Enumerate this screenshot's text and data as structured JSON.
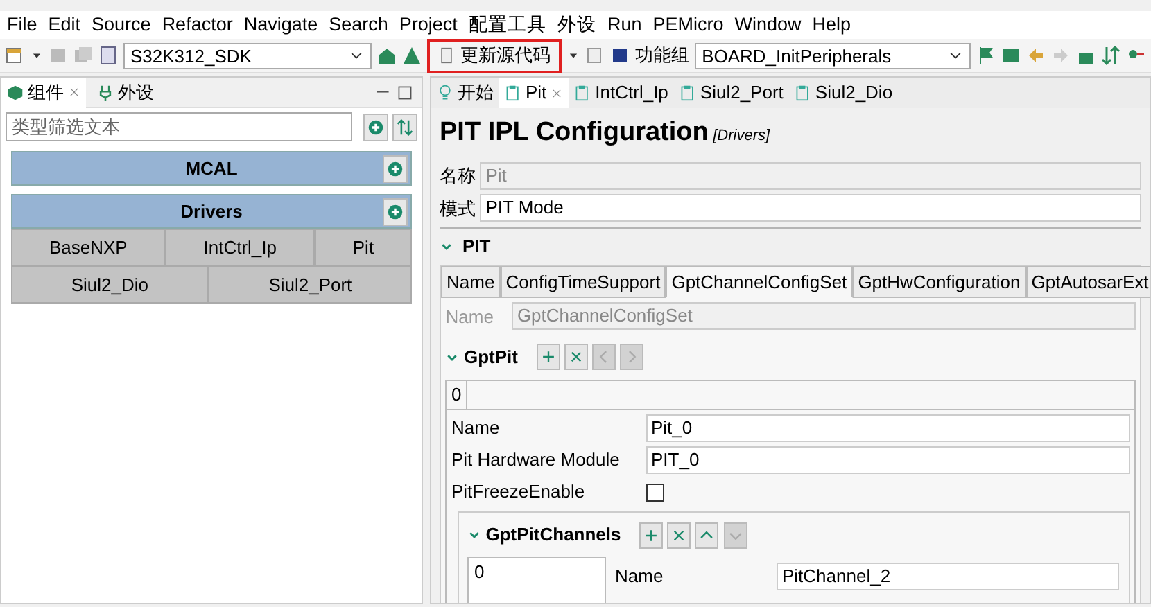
{
  "menu": [
    "File",
    "Edit",
    "Source",
    "Refactor",
    "Navigate",
    "Search",
    "Project",
    "配置工具",
    "外设",
    "Run",
    "PEMicro",
    "Window",
    "Help"
  ],
  "toolbar": {
    "sdk": "S32K312_SDK",
    "update_button": {
      "label": "更新源代码",
      "highlighted": true
    },
    "function_group_label": "功能组",
    "function_group": "BOARD_InitPeripherals"
  },
  "left_panel": {
    "tabs": [
      {
        "label": "组件",
        "selected": true
      },
      {
        "label": "外设",
        "selected": false
      }
    ],
    "filter": {
      "placeholder": "类型筛选文本"
    },
    "groups": [
      {
        "title": "MCAL"
      },
      {
        "title": "Drivers",
        "rows": [
          [
            "BaseNXP",
            "IntCtrl_Ip",
            "Pit"
          ],
          [
            "Siul2_Dio",
            "Siul2_Port"
          ]
        ]
      }
    ]
  },
  "editor_tabs": [
    {
      "label": "开始",
      "kind": "start",
      "selected": false
    },
    {
      "label": "Pit",
      "kind": "component",
      "selected": true
    },
    {
      "label": "IntCtrl_Ip",
      "kind": "component",
      "selected": false
    },
    {
      "label": "Siul2_Port",
      "kind": "component",
      "selected": false
    },
    {
      "label": "Siul2_Dio",
      "kind": "component",
      "selected": false
    }
  ],
  "editor": {
    "title": "PIT IPL Configuration",
    "subtitle": "[Drivers]",
    "fields": [
      {
        "label": "名称",
        "value": "Pit",
        "disabled": true
      },
      {
        "label": "模式",
        "value": "PIT Mode",
        "disabled": false
      }
    ],
    "section": {
      "title": "PIT",
      "expanded": true,
      "tabs": [
        {
          "label": "Name",
          "selected": false
        },
        {
          "label": "ConfigTimeSupport",
          "selected": false
        },
        {
          "label": "GptChannelConfigSet",
          "selected": true
        },
        {
          "label": "GptHwConfiguration",
          "selected": false
        },
        {
          "label": "GptAutosarExt",
          "selected": false
        }
      ],
      "name_row": {
        "label": "Name",
        "value": "GptChannelConfigSet"
      },
      "gpt_pit": {
        "title": "GptPit",
        "expanded": true,
        "buttons": [
          {
            "kind": "add",
            "disabled": false
          },
          {
            "kind": "remove",
            "disabled": false
          },
          {
            "kind": "prev",
            "disabled": true
          },
          {
            "kind": "next",
            "disabled": true
          }
        ],
        "index_tab": "0",
        "fields": [
          {
            "kind": "text",
            "label": "Name",
            "value": "Pit_0"
          },
          {
            "kind": "text",
            "label": "Pit Hardware Module",
            "value": "PIT_0"
          },
          {
            "kind": "checkbox",
            "label": "PitFreezeEnable",
            "checked": false
          }
        ],
        "channels": {
          "title": "GptPitChannels",
          "expanded": true,
          "buttons": [
            {
              "kind": "add",
              "disabled": false
            },
            {
              "kind": "remove",
              "disabled": false
            },
            {
              "kind": "up",
              "disabled": false
            },
            {
              "kind": "down",
              "disabled": true
            }
          ],
          "list": [
            "0"
          ],
          "name_label": "Name",
          "name_value": "PitChannel_2"
        }
      }
    }
  }
}
